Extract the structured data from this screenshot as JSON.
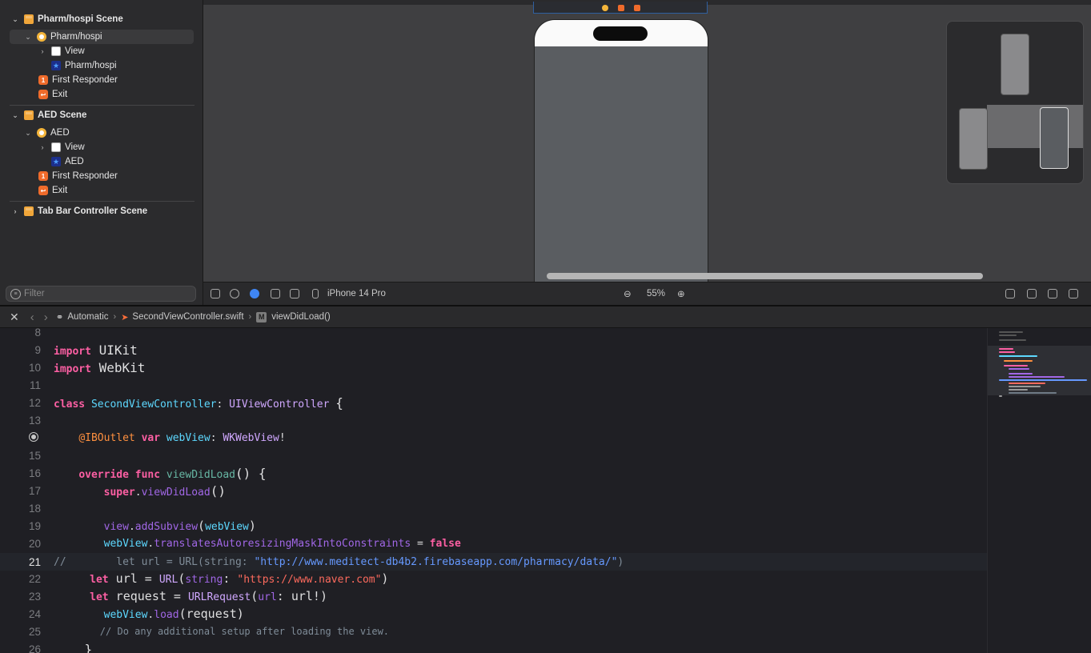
{
  "outline": {
    "scenes": [
      {
        "title": "Pharm/hospi Scene",
        "controller": "Pharm/hospi",
        "children": [
          "View",
          "Pharm/hospi"
        ],
        "first_responder": "First Responder",
        "exit": "Exit"
      },
      {
        "title": "AED Scene",
        "controller": "AED",
        "children": [
          "View",
          "AED"
        ],
        "first_responder": "First Responder",
        "exit": "Exit"
      },
      {
        "title": "Tab Bar Controller Scene"
      }
    ],
    "filter_placeholder": "Filter"
  },
  "canvas_toolbar": {
    "device": "iPhone 14 Pro",
    "zoom": "55%"
  },
  "jump_bar": {
    "mode": "Automatic",
    "file": "SecondViewController.swift",
    "symbol_badge": "M",
    "symbol": "viewDidLoad()"
  },
  "editor": {
    "current_line": 21,
    "lines": [
      {
        "n": "8",
        "text": ""
      },
      {
        "n": "9",
        "text": "import UIKit"
      },
      {
        "n": "10",
        "text": "import WebKit"
      },
      {
        "n": "11",
        "text": ""
      },
      {
        "n": "12",
        "text": "class SecondViewController: UIViewController {"
      },
      {
        "n": "13",
        "text": ""
      },
      {
        "n": "",
        "text": "    @IBOutlet var webView: WKWebView!"
      },
      {
        "n": "15",
        "text": ""
      },
      {
        "n": "16",
        "text": "    override func viewDidLoad() {"
      },
      {
        "n": "17",
        "text": "        super.viewDidLoad()"
      },
      {
        "n": "18",
        "text": ""
      },
      {
        "n": "19",
        "text": "        view.addSubview(webView)"
      },
      {
        "n": "20",
        "text": "        webView.translatesAutoresizingMaskIntoConstraints = false"
      },
      {
        "n": "21",
        "text": "//        let url = URL(string: \"http://www.meditect-db4b2.firebaseapp.com/pharmacy/data/\")"
      },
      {
        "n": "22",
        "text": "        let url = URL(string: \"https://www.naver.com\")"
      },
      {
        "n": "23",
        "text": "        let request = URLRequest(url: url!)"
      },
      {
        "n": "24",
        "text": "        webView.load(request)"
      },
      {
        "n": "25",
        "text": "        // Do any additional setup after loading the view."
      },
      {
        "n": "26",
        "text": "    }"
      }
    ]
  }
}
